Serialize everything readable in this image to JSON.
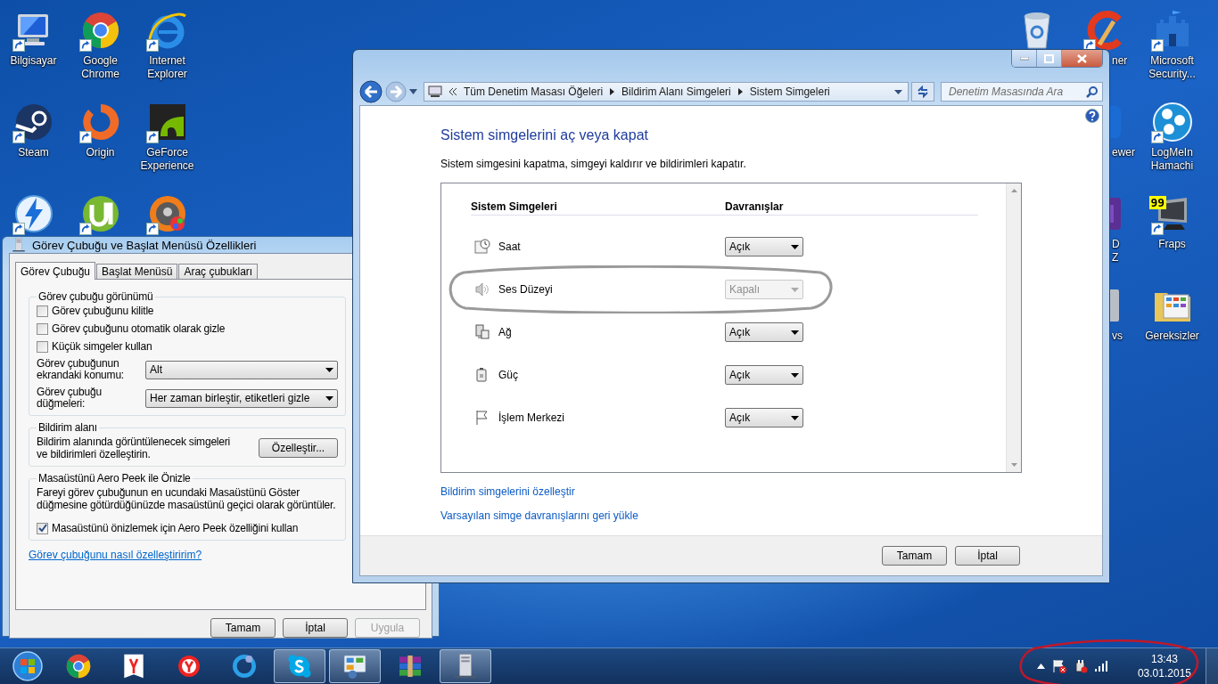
{
  "desktop": {
    "left_columns": [
      [
        {
          "label": "Bilgisayar",
          "shortcut": true
        },
        {
          "label": "Steam",
          "shortcut": true
        },
        {
          "shortcut": true
        }
      ],
      [
        {
          "label": "Google Chrome",
          "shortcut": true
        },
        {
          "label": "Origin",
          "shortcut": true
        },
        {
          "shortcut": true
        }
      ],
      [
        {
          "label": "Internet Explorer",
          "shortcut": true
        },
        {
          "label": "GeForce Experience",
          "shortcut": true
        },
        {
          "shortcut": true
        }
      ]
    ],
    "right_columns": [
      [
        {
          "shortcut": false
        }
      ],
      [
        {
          "label": "ner",
          "shortcut": true
        },
        {
          "label": "ewer",
          "shortcut": false
        },
        {
          "label": "D Z",
          "shortcut": false
        },
        {
          "label": "vs",
          "shortcut": false
        }
      ],
      [
        {
          "label": "Microsoft Security...",
          "shortcut": true
        },
        {
          "label": "LogMeIn Hamachi",
          "shortcut": true
        },
        {
          "label": "Fraps",
          "shortcut": true,
          "badge": "99"
        },
        {
          "label": "Gereksizler",
          "shortcut": false
        }
      ]
    ]
  },
  "dialog": {
    "title": "Görev Çubuğu ve Başlat Menüsü Özellikleri",
    "tabs": [
      {
        "label": "Görev Çubuğu",
        "selected": true
      },
      {
        "label": "Başlat Menüsü",
        "selected": false
      },
      {
        "label": "Araç çubukları",
        "selected": false
      }
    ],
    "appearance": {
      "title": "Görev çubuğu görünümü",
      "checkboxes": [
        {
          "label": "Görev çubuğunu kilitle",
          "checked": false
        },
        {
          "label": "Görev çubuğunu otomatik olarak gizle",
          "checked": false
        },
        {
          "label": "Küçük simgeler kullan",
          "checked": false
        }
      ],
      "selects": [
        {
          "label": "Görev çubuğunun ekrandaki konumu:",
          "value": "Alt"
        },
        {
          "label": "Görev çubuğu düğmeleri:",
          "value": "Her zaman birleştir, etiketleri gizle"
        }
      ]
    },
    "notification_area": {
      "title": "Bildirim alanı",
      "text": "Bildirim alanında görüntülenecek simgeleri ve bildirimleri özelleştirin.",
      "button": "Özelleştir..."
    },
    "aero_peek": {
      "title": "Masaüstünü Aero Peek ile Önizle",
      "text": "Fareyi görev çubuğunun en ucundaki Masaüstünü Göster düğmesine götürdüğünüzde masaüstünü geçici olarak görüntüler.",
      "checkbox": {
        "label": "Masaüstünü önizlemek için Aero Peek özelliğini kullan",
        "checked": true
      }
    },
    "help_link": "Görev çubuğunu nasıl özelleştiririm?",
    "buttons": [
      {
        "label": "Tamam",
        "disabled": false
      },
      {
        "label": "İptal",
        "disabled": false
      },
      {
        "label": "Uygula",
        "disabled": true
      }
    ]
  },
  "main": {
    "address": {
      "path": [
        "Tüm Denetim Masası Öğeleri",
        "Bildirim Alanı Simgeleri",
        "Sistem Simgeleri"
      ]
    },
    "search": {
      "placeholder": "Denetim Masasında Ara"
    },
    "heading": "Sistem simgelerini aç veya kapat",
    "description": "Sistem simgesini kapatma, simgeyi kaldırır ve bildirimleri kapatır.",
    "table": {
      "columns": [
        "Sistem Simgeleri",
        "Davranışlar"
      ],
      "rows": [
        {
          "name": "Saat",
          "value": "Açık",
          "disabled": false,
          "circled": false
        },
        {
          "name": "Ses Düzeyi",
          "value": "Kapalı",
          "disabled": true,
          "circled": true
        },
        {
          "name": "Ağ",
          "value": "Açık",
          "disabled": false,
          "circled": false
        },
        {
          "name": "Güç",
          "value": "Açık",
          "disabled": false,
          "circled": false
        },
        {
          "name": "İşlem Merkezi",
          "value": "Açık",
          "disabled": false,
          "circled": false
        }
      ]
    },
    "links": [
      "Bildirim simgelerini özelleştir",
      "Varsayılan simge davranışlarını geri yükle"
    ],
    "buttons": [
      "Tamam",
      "İptal"
    ]
  },
  "taskbar": {
    "items": [
      {
        "active": false
      },
      {
        "active": false
      },
      {
        "active": false
      },
      {
        "active": false
      },
      {
        "active": true
      },
      {
        "active": true
      },
      {
        "active": false
      },
      {
        "active": true
      }
    ],
    "tray": {
      "time": "13:43",
      "date": "03.01.2015",
      "circled": true
    }
  }
}
